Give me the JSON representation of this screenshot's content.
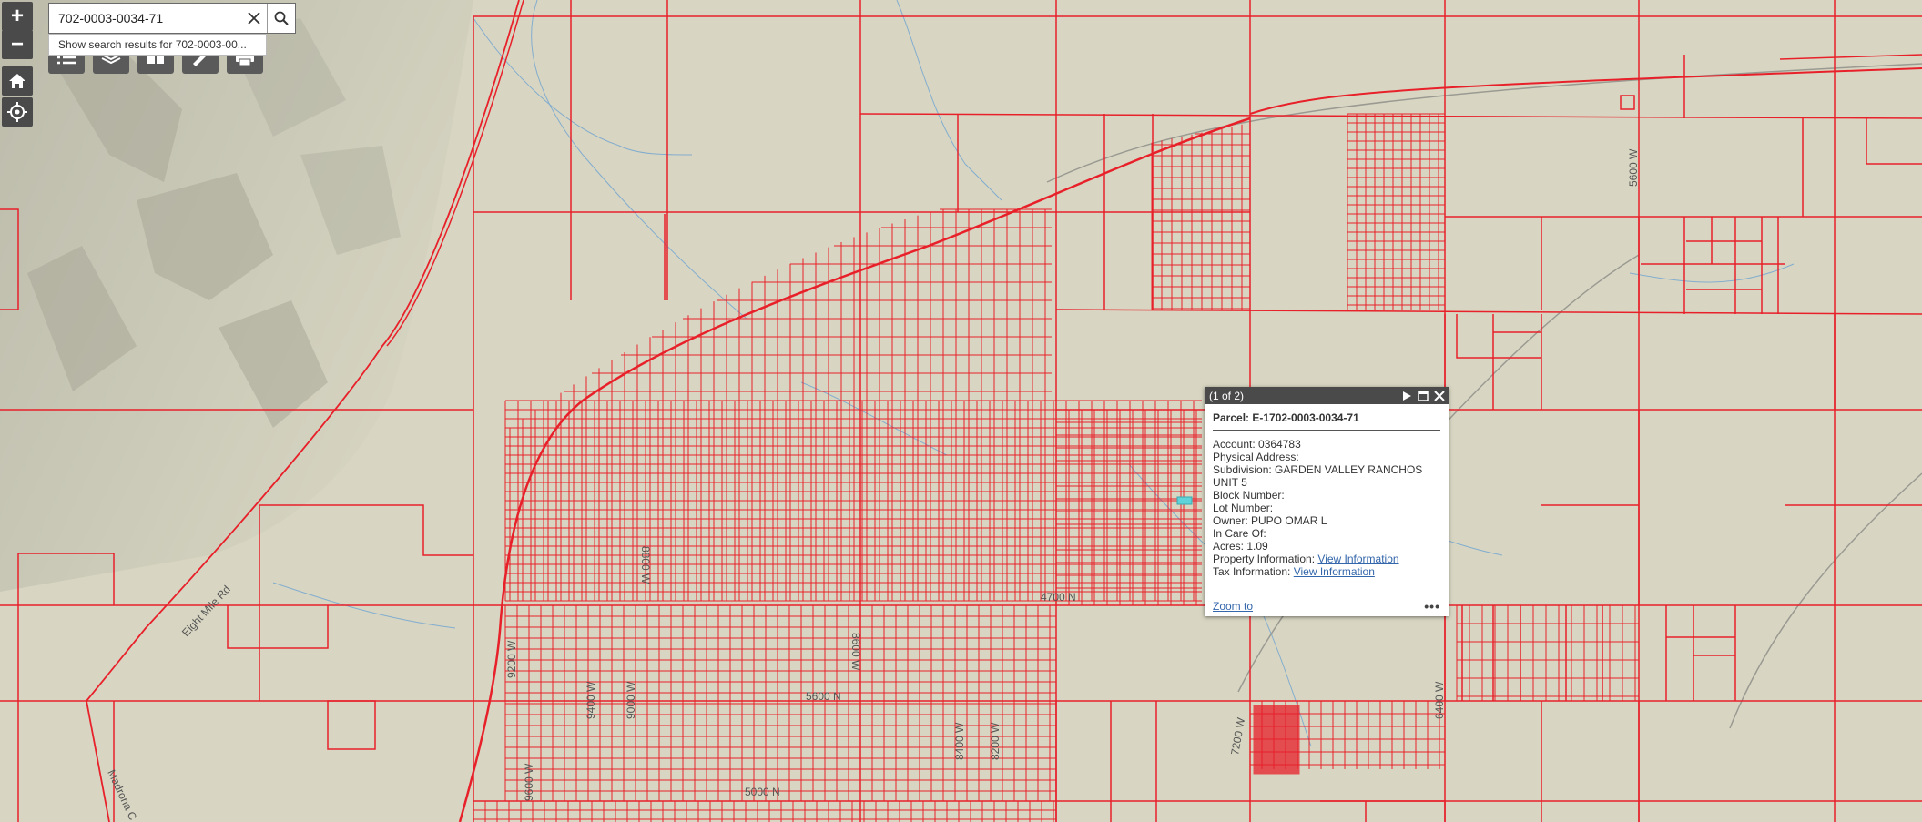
{
  "search": {
    "value": "702-0003-0034-71",
    "suggestion": "Show search results for 702-0003-00..."
  },
  "zoom": {
    "in_label": "+",
    "out_label": "−"
  },
  "toolbar": [
    "list-icon",
    "layers-icon",
    "basemap-gallery-icon",
    "measure-icon",
    "print-icon"
  ],
  "popup": {
    "counter": "(1 of 2)",
    "title": "Parcel: E-1702-0003-0034-71",
    "account": "Account: 0364783",
    "physical_address": "Physical Address:",
    "subdivision_line1": "Subdivision: GARDEN VALLEY RANCHOS",
    "subdivision_line2": "UNIT 5",
    "block": "Block Number:",
    "lot": "Lot Number:",
    "owner": "Owner: PUPO OMAR L",
    "care_of": "In Care Of:",
    "acres": "Acres: 1.09",
    "property_info_label": "Property Information:",
    "tax_info_label": "Tax Information:",
    "view_info_link": "View Information",
    "zoom_to": "Zoom to",
    "more": "•••"
  },
  "map_labels": {
    "road_eight_mile": "Eight Mile Rd",
    "road_madrona": "Madrona C",
    "w5600": "5600 W",
    "w7200": "7200 W",
    "w6400": "6400 W",
    "n5600": "5600 N",
    "n5000": "5000 N",
    "w8600": "8600 W",
    "w8800": "8800 W",
    "w9200": "9200 W",
    "w9600": "9600 W",
    "w8200": "8200 W",
    "w9000": "9000 W",
    "n4700": "4700 N",
    "w9400": "9400 W",
    "w8400": "8400 W"
  },
  "colors": {
    "parcel": "#e8202a",
    "terrain": "#d8d6c2",
    "accent": "#4a4a4a",
    "selected": "#5fd3d9"
  }
}
